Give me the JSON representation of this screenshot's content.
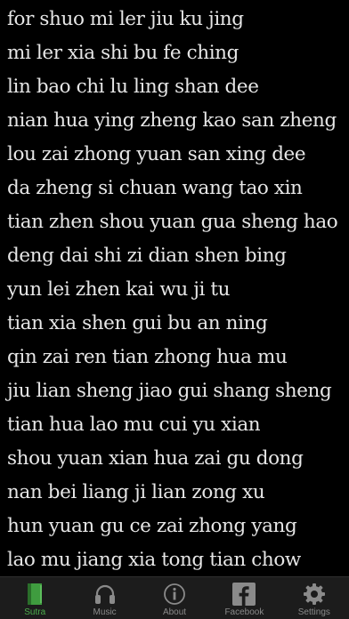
{
  "lines": [
    "for shuo mi ler jiu ku jing",
    "mi ler xia shi bu fe ching",
    "lin bao chi lu ling shan dee",
    "nian hua ying zheng kao san zheng",
    "lou zai zhong yuan san xing dee",
    "da zheng si chuan wang tao xin",
    "tian zhen shou yuan gua sheng hao",
    "deng dai shi zi dian shen bing",
    "yun lei zhen kai wu ji tu",
    "tian xia shen gui bu an ning",
    "qin zai ren tian zhong hua mu",
    "jiu lian sheng jiao gui shang sheng",
    "tian hua lao mu cui yu xian",
    "shou yuan xian hua zai gu dong",
    "nan bei liang ji lian zong xu",
    "hun yuan gu ce zai zhong yang",
    "lao mu jiang xia tong tian chow"
  ],
  "tabbar": {
    "tabs": [
      {
        "label": "Sutra",
        "icon": "book-icon",
        "active": true
      },
      {
        "label": "Music",
        "icon": "headphones-icon",
        "active": false
      },
      {
        "label": "About",
        "icon": "info-icon",
        "active": false
      },
      {
        "label": "Facebook",
        "icon": "facebook-icon",
        "active": false
      },
      {
        "label": "Settings",
        "icon": "gear-icon",
        "active": false
      }
    ]
  },
  "colors": {
    "background": "#000000",
    "text": "#e6e6e6",
    "tabbar_background": "#1c1c1c",
    "active_tab": "#4cae4c",
    "inactive_tab": "#8a8a8a"
  }
}
